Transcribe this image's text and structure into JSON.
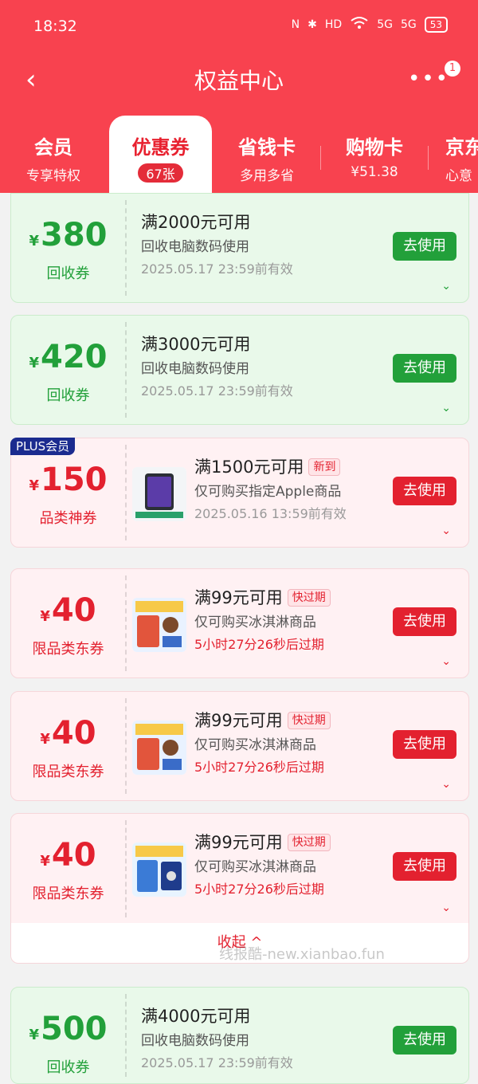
{
  "status": {
    "time": "18:32",
    "battery": "53",
    "signal1": "5G",
    "signal2": "5G"
  },
  "nav": {
    "back": "‹",
    "title": "权益中心",
    "more": "•••",
    "badge": "1"
  },
  "tabs": [
    {
      "label": "会员",
      "sub": "专享特权"
    },
    {
      "label": "优惠券",
      "sub": "67张"
    },
    {
      "label": "省钱卡",
      "sub": "多用多省"
    },
    {
      "label": "购物卡",
      "sub": "¥51.38"
    },
    {
      "label": "京东",
      "sub": "心意"
    }
  ],
  "currency": "¥",
  "use_label": "去使用",
  "plus_badge": "PLUS会员",
  "coupons": [
    {
      "amount": "380",
      "type": "回收券",
      "cond": "满2000元可用",
      "tag": "",
      "desc": "回收电脑数码使用",
      "valid": "2025.05.17 23:59前有效",
      "color": "green"
    },
    {
      "amount": "420",
      "type": "回收券",
      "cond": "满3000元可用",
      "tag": "",
      "desc": "回收电脑数码使用",
      "valid": "2025.05.17 23:59前有效",
      "color": "green"
    },
    {
      "amount": "150",
      "type": "品类神券",
      "cond": "满1500元可用",
      "tag": "新到",
      "desc": "仅可购买指定Apple商品",
      "valid": "2025.05.16 13:59前有效",
      "color": "pink"
    },
    {
      "amount": "40",
      "type": "限品类东券",
      "cond": "满99元可用",
      "tag": "快过期",
      "desc": "仅可购买冰淇淋商品",
      "valid": "5小时27分26秒后过期",
      "color": "pink"
    },
    {
      "amount": "40",
      "type": "限品类东券",
      "cond": "满99元可用",
      "tag": "快过期",
      "desc": "仅可购买冰淇淋商品",
      "valid": "5小时27分26秒后过期",
      "color": "pink"
    },
    {
      "amount": "40",
      "type": "限品类东券",
      "cond": "满99元可用",
      "tag": "快过期",
      "desc": "仅可购买冰淇淋商品",
      "valid": "5小时27分26秒后过期",
      "color": "pink"
    },
    {
      "amount": "500",
      "type": "回收券",
      "cond": "满4000元可用",
      "tag": "",
      "desc": "回收电脑数码使用",
      "valid": "2025.05.17 23:59前有效",
      "color": "green"
    }
  ],
  "collapse_label": "收起 ^",
  "watermark": "线报酷-new.xianbao.fun"
}
